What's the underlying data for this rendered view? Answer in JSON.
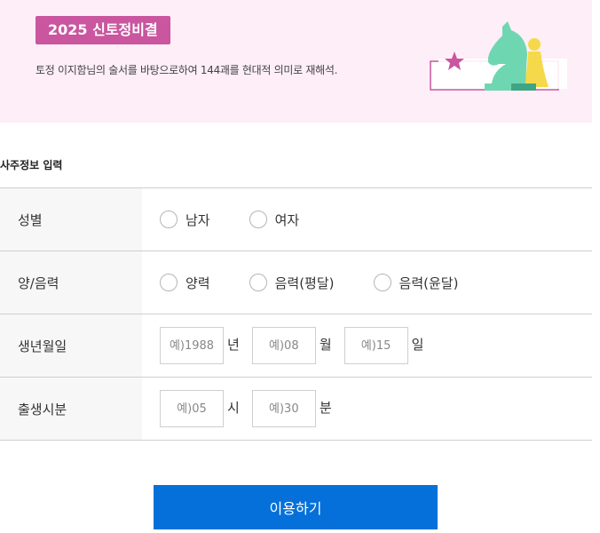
{
  "banner": {
    "badge": "2025 신토정비결",
    "subtitle": "토정 이지함님의 술서를 바탕으로하여 144괘를 현대적 의미로 재해석."
  },
  "section_title": "사주정보 입력",
  "gender": {
    "label": "성별",
    "options": [
      "남자",
      "여자"
    ]
  },
  "calendar": {
    "label": "양/음력",
    "options": [
      "양력",
      "음력(평달)",
      "음력(윤달)"
    ]
  },
  "birthdate": {
    "label": "생년월일",
    "year_placeholder": "예)1988",
    "year_unit": "년",
    "month_placeholder": "예)08",
    "month_unit": "월",
    "day_placeholder": "예)15",
    "day_unit": "일"
  },
  "birthtime": {
    "label": "출생시분",
    "hour_placeholder": "예)05",
    "hour_unit": "시",
    "minute_placeholder": "예)30",
    "minute_unit": "분"
  },
  "submit_label": "이용하기",
  "colors": {
    "banner_bg": "#fdeef8",
    "badge_bg": "#c9569f",
    "button_bg": "#0570d9"
  }
}
